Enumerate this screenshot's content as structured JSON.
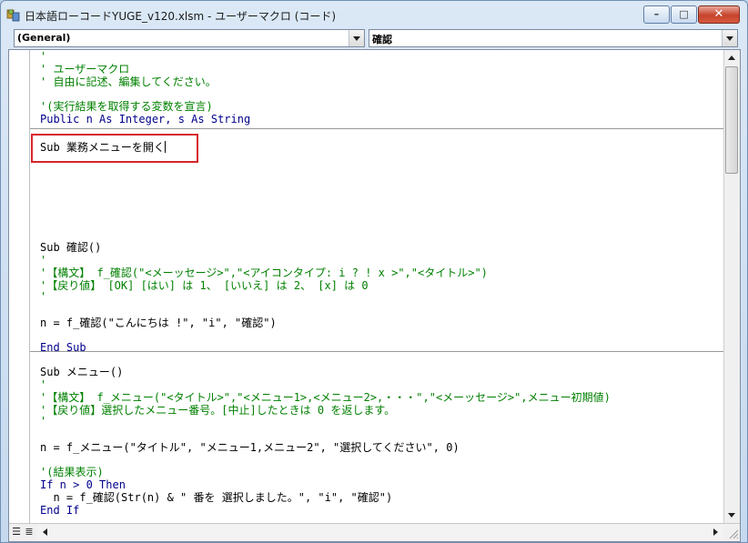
{
  "window": {
    "title": "日本語ローコードYUGE_v120.xlsm - ユーザーマクロ (コード)",
    "buttons": {
      "minimize": "–",
      "maximize": "□",
      "close": "✕"
    }
  },
  "object_combo": {
    "value": "(General)"
  },
  "procedure_combo": {
    "value": "確認"
  },
  "code_lines": [
    {
      "text": "'",
      "kind": "comment"
    },
    {
      "text": "' ユーザーマクロ",
      "kind": "comment"
    },
    {
      "text": "' 自由に記述、編集してください。",
      "kind": "comment"
    },
    {
      "text": "'(実行結果を取得する変数を宣言)",
      "kind": "comment"
    },
    {
      "text": "Public n As Integer, s As String",
      "kind": "keyword"
    },
    {
      "text": "Sub 業務メニューを開く",
      "kind": "normal"
    },
    {
      "text": "Sub 確認()",
      "kind": "normal"
    },
    {
      "text": "'",
      "kind": "comment"
    },
    {
      "text": "'【構文】 f_確認(\"<メーッセージ>\",\"<アイコンタイプ: i ? ! x >\",\"<タイトル>\")",
      "kind": "comment"
    },
    {
      "text": "'【戻り値】 [OK] [はい] は 1、 [いいえ] は 2、 [x] は 0",
      "kind": "comment"
    },
    {
      "text": "'",
      "kind": "comment"
    },
    {
      "text": "n = f_確認(\"こんにちは !\", \"i\", \"確認\")",
      "kind": "normal"
    },
    {
      "text": "End Sub",
      "kind": "keyword"
    },
    {
      "text": "Sub メニュー()",
      "kind": "normal"
    },
    {
      "text": "'",
      "kind": "comment"
    },
    {
      "text": "'【構文】 f_メニュー(\"<タイトル>\",\"<メニュー1>,<メニュー2>,・・・\",\"<メーッセージ>\",メニュー初期値)",
      "kind": "comment"
    },
    {
      "text": "'【戻り値】選択したメニュー番号。[中止]したときは 0 を返します。",
      "kind": "comment"
    },
    {
      "text": "'",
      "kind": "comment"
    },
    {
      "text": "n = f_メニュー(\"タイトル\", \"メニュー1,メニュー2\", \"選択してください\", 0)",
      "kind": "normal"
    },
    {
      "text": "'(結果表示)",
      "kind": "comment"
    },
    {
      "text": "If n > 0 Then",
      "kind": "keyword"
    },
    {
      "text": "  n = f_確認(Str(n) & \" 番を 選択しました。\", \"i\", \"確認\")",
      "kind": "normal"
    },
    {
      "text": "End If",
      "kind": "keyword"
    }
  ],
  "bottom": {
    "procedure_view_icon": "☰",
    "module_view_icon": "≣"
  },
  "icons": {
    "app": "vba-editor-icon",
    "scroll_up": "arrow-up-icon",
    "scroll_down": "arrow-down-icon",
    "scroll_left": "arrow-left-icon",
    "scroll_right": "arrow-right-icon",
    "resize": "size-grip-icon"
  },
  "colors": {
    "comment": "#008000",
    "keyword": "#00008b",
    "highlight_box": "#d7242b",
    "close_button": "#c6432b"
  }
}
